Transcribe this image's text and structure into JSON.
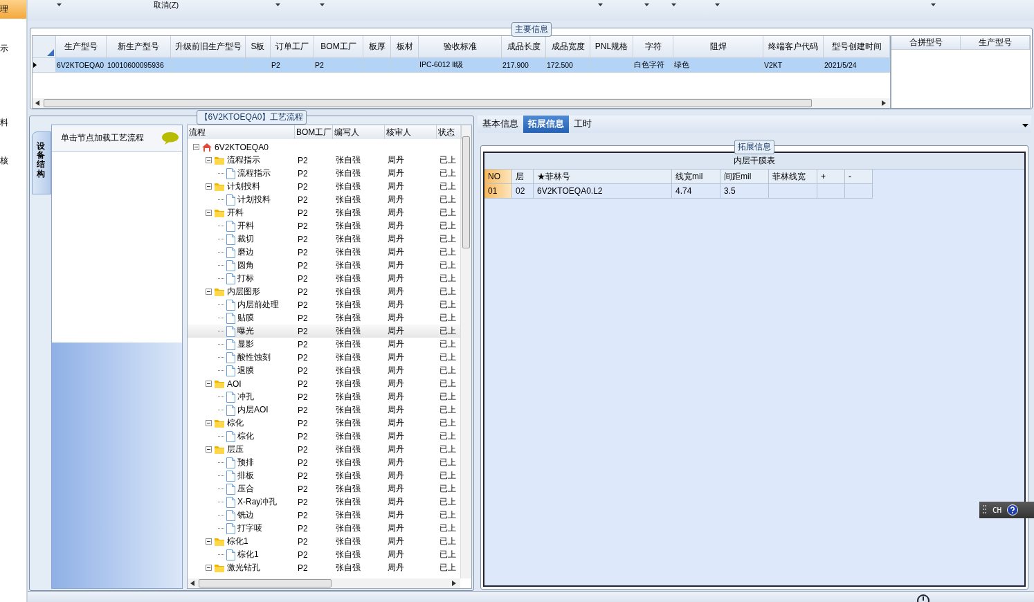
{
  "left_nav": [
    {
      "label": "理",
      "selected": true
    },
    {
      "label": "示",
      "selected": false
    },
    {
      "label": "料",
      "selected": false
    },
    {
      "label": "核",
      "selected": false
    }
  ],
  "toolbar": {
    "cancel": "取消(Z)"
  },
  "main_info": {
    "title": "主要信息",
    "columns": [
      "生产型号",
      "新生产型号",
      "升级前旧生产型号",
      "S板",
      "订单工厂",
      "BOM工厂",
      "板厚",
      "板材",
      "验收标准",
      "成品长度",
      "成品宽度",
      "PNL规格",
      "字符",
      "阻焊",
      "终端客户代码",
      "型号创建时间"
    ],
    "rows": [
      {
        "selected": true,
        "cells": [
          "6V2KTOEQA0",
          "10010600095936",
          null,
          null,
          "P2",
          "P2",
          null,
          null,
          "IPC-6012 Ⅱ级",
          "217.900",
          "172.500",
          null,
          "白色字符",
          "绿色",
          "V2KT",
          "2021/5/24"
        ]
      }
    ],
    "merge_columns": [
      "合拼型号",
      "生产型号"
    ]
  },
  "process": {
    "title": "【6V2KTOEQA0】工艺流程",
    "side_tab": "设备结构",
    "hint": "单击节点加载工艺流程",
    "columns": [
      "流程",
      "BOM工厂",
      "编写人",
      "核审人",
      "状态"
    ],
    "tree": [
      {
        "kind": "root",
        "name": "6V2KTOEQA0",
        "expanded": true,
        "selected": false,
        "children": [
          {
            "kind": "folder",
            "name": "流程指示",
            "bom": "P2",
            "writer": "张自强",
            "reviewer": "周丹",
            "status": "已上",
            "expanded": true,
            "selected": false,
            "children": [
              {
                "kind": "step",
                "name": "流程指示",
                "bom": "P2",
                "writer": "张自强",
                "reviewer": "周丹",
                "status": "已上",
                "selected": false
              }
            ]
          },
          {
            "kind": "folder",
            "name": "计划投料",
            "bom": "P2",
            "writer": "张自强",
            "reviewer": "周丹",
            "status": "已上",
            "expanded": true,
            "selected": false,
            "children": [
              {
                "kind": "step",
                "name": "计划投料",
                "bom": "P2",
                "writer": "张自强",
                "reviewer": "周丹",
                "status": "已上",
                "selected": false
              }
            ]
          },
          {
            "kind": "folder",
            "name": "开料",
            "bom": "P2",
            "writer": "张自强",
            "reviewer": "周丹",
            "status": "已上",
            "expanded": true,
            "selected": false,
            "children": [
              {
                "kind": "step",
                "name": "开料",
                "bom": "P2",
                "writer": "张自强",
                "reviewer": "周丹",
                "status": "已上",
                "selected": false
              },
              {
                "kind": "step",
                "name": "裁切",
                "bom": "P2",
                "writer": "张自强",
                "reviewer": "周丹",
                "status": "已上",
                "selected": false
              },
              {
                "kind": "step",
                "name": "磨边",
                "bom": "P2",
                "writer": "张自强",
                "reviewer": "周丹",
                "status": "已上",
                "selected": false
              },
              {
                "kind": "step",
                "name": "圆角",
                "bom": "P2",
                "writer": "张自强",
                "reviewer": "周丹",
                "status": "已上",
                "selected": false
              },
              {
                "kind": "step",
                "name": "打标",
                "bom": "P2",
                "writer": "张自强",
                "reviewer": "周丹",
                "status": "已上",
                "selected": false
              }
            ]
          },
          {
            "kind": "folder",
            "name": "内层图形",
            "bom": "P2",
            "writer": "张自强",
            "reviewer": "周丹",
            "status": "已上",
            "expanded": true,
            "selected": false,
            "children": [
              {
                "kind": "step",
                "name": "内层前处理",
                "bom": "P2",
                "writer": "张自强",
                "reviewer": "周丹",
                "status": "已上",
                "selected": false
              },
              {
                "kind": "step",
                "name": "贴膜",
                "bom": "P2",
                "writer": "张自强",
                "reviewer": "周丹",
                "status": "已上",
                "selected": false
              },
              {
                "kind": "step",
                "name": "曝光",
                "bom": "P2",
                "writer": "张自强",
                "reviewer": "周丹",
                "status": "已上",
                "selected": true
              },
              {
                "kind": "step",
                "name": "显影",
                "bom": "P2",
                "writer": "张自强",
                "reviewer": "周丹",
                "status": "已上",
                "selected": false
              },
              {
                "kind": "step",
                "name": "酸性蚀刻",
                "bom": "P2",
                "writer": "张自强",
                "reviewer": "周丹",
                "status": "已上",
                "selected": false
              },
              {
                "kind": "step",
                "name": "退膜",
                "bom": "P2",
                "writer": "张自强",
                "reviewer": "周丹",
                "status": "已上",
                "selected": false
              }
            ]
          },
          {
            "kind": "folder",
            "name": "AOI",
            "bom": "P2",
            "writer": "张自强",
            "reviewer": "周丹",
            "status": "已上",
            "expanded": true,
            "selected": false,
            "children": [
              {
                "kind": "step",
                "name": "冲孔",
                "bom": "P2",
                "writer": "张自强",
                "reviewer": "周丹",
                "status": "已上",
                "selected": false
              },
              {
                "kind": "step",
                "name": "内层AOI",
                "bom": "P2",
                "writer": "张自强",
                "reviewer": "周丹",
                "status": "已上",
                "selected": false
              }
            ]
          },
          {
            "kind": "folder",
            "name": "棕化",
            "bom": "P2",
            "writer": "张自强",
            "reviewer": "周丹",
            "status": "已上",
            "expanded": true,
            "selected": false,
            "children": [
              {
                "kind": "step",
                "name": "棕化",
                "bom": "P2",
                "writer": "张自强",
                "reviewer": "周丹",
                "status": "已上",
                "selected": false
              }
            ]
          },
          {
            "kind": "folder",
            "name": "层压",
            "bom": "P2",
            "writer": "张自强",
            "reviewer": "周丹",
            "status": "已上",
            "expanded": true,
            "selected": false,
            "children": [
              {
                "kind": "step",
                "name": "预排",
                "bom": "P2",
                "writer": "张自强",
                "reviewer": "周丹",
                "status": "已上",
                "selected": false
              },
              {
                "kind": "step",
                "name": "排板",
                "bom": "P2",
                "writer": "张自强",
                "reviewer": "周丹",
                "status": "已上",
                "selected": false
              },
              {
                "kind": "step",
                "name": "压合",
                "bom": "P2",
                "writer": "张自强",
                "reviewer": "周丹",
                "status": "已上",
                "selected": false
              },
              {
                "kind": "step",
                "name": "X-Ray冲孔",
                "bom": "P2",
                "writer": "张自强",
                "reviewer": "周丹",
                "status": "已上",
                "selected": false
              },
              {
                "kind": "step",
                "name": "铣边",
                "bom": "P2",
                "writer": "张自强",
                "reviewer": "周丹",
                "status": "已上",
                "selected": false
              },
              {
                "kind": "step",
                "name": "打字唛",
                "bom": "P2",
                "writer": "张自强",
                "reviewer": "周丹",
                "status": "已上",
                "selected": false
              }
            ]
          },
          {
            "kind": "folder",
            "name": "棕化1",
            "bom": "P2",
            "writer": "张自强",
            "reviewer": "周丹",
            "status": "已上",
            "expanded": true,
            "selected": false,
            "children": [
              {
                "kind": "step",
                "name": "棕化1",
                "bom": "P2",
                "writer": "张自强",
                "reviewer": "周丹",
                "status": "已上",
                "selected": false
              }
            ]
          },
          {
            "kind": "folder",
            "name": "激光钻孔",
            "bom": "P2",
            "writer": "张自强",
            "reviewer": "周丹",
            "status": "已上",
            "expanded": true,
            "selected": false
          }
        ]
      }
    ]
  },
  "detail": {
    "tabs": [
      {
        "label": "基本信息",
        "selected": false
      },
      {
        "label": "拓展信息",
        "selected": true
      },
      {
        "label": "工时",
        "selected": false
      }
    ],
    "group_title": "拓展信息",
    "table_title": "内层干膜表",
    "columns": [
      "NO",
      "层",
      "★菲林号",
      "线宽mil",
      "间距mil",
      "菲林线宽",
      "+",
      "-"
    ],
    "rows": [
      {
        "selected": true,
        "cells": [
          "01",
          "02",
          "6V2KTOEQA0.L2",
          "4.74",
          "3.5",
          null,
          null,
          null
        ]
      }
    ]
  },
  "ime": {
    "label": "CH"
  }
}
